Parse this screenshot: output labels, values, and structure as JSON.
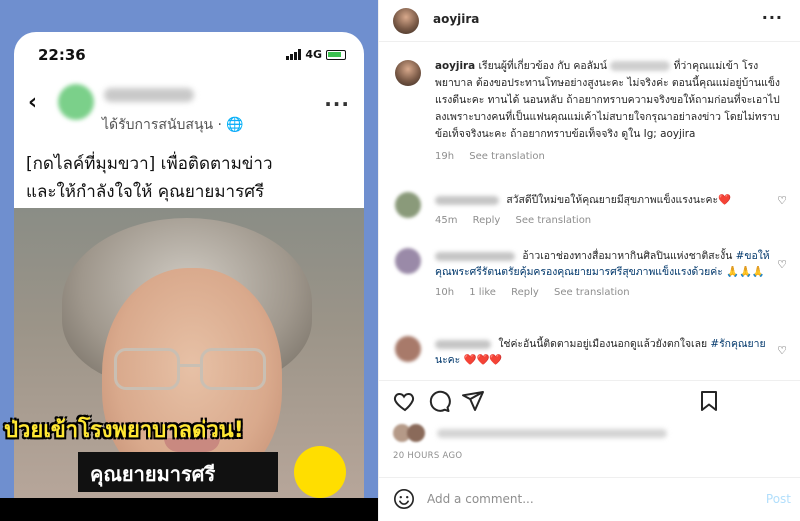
{
  "left": {
    "status_time": "22:36",
    "network": "4G",
    "fb_sponsored": "ได้รับการสนับสนุน · 🌐",
    "fb_text_line1": "[กดไลค์ที่มุมขวา] เพื่อติดตามข่าว",
    "fb_text_line2": "และให้กำลังใจให้ คุณยายมารศรี",
    "banner": "ป่วยเข้าโรงพยาบาลด่วน!",
    "banner2": "คุณยายมารศรี",
    "back_glyph": "‹",
    "more_glyph": "···"
  },
  "header": {
    "username": "aoyjira",
    "more_glyph": "···"
  },
  "caption": {
    "username": "aoyjira",
    "text_a": "เรียนผู้ที่เกี่ยวข้อง กับ คอลัมน์",
    "text_b": "ที่ว่าคุณแม่เข้า โรงพยาบาล ต้องขอประทานโทษอย่างสูงนะคะ ไม่จริงค่ะ ตอนนี้คุณแม่อยู่บ้านแข็งแรงดีนะคะ ทานได้ นอนหลับ ถ้าอยากทราบความจริงขอให้ถามก่อนที่จะเอาไปลงเพราะบางคนที่เป็นแฟนคุณแม่เค้าไม่สบายใจกรุณาอย่าลงข่าว โดยไม่ทราบข้อเท็จจริงนะคะ ถ้าอยากทราบข้อเท็จจริง ดูใน Ig; aoyjira",
    "time": "19h",
    "see_translation": "See translation"
  },
  "comments": [
    {
      "text": "สวัสดีปีใหม่ขอให้คุณยายมีสุขภาพแข็งแรงนะคะ❤️",
      "tag": "",
      "time": "45m",
      "likes": "",
      "reply": "Reply",
      "see_translation": "See translation"
    },
    {
      "text": "อ้าวเอาช่องทางสื่อมาหากินศิลปินแห่งชาติสะงั้น",
      "tag": "#ขอให้คุณพระศรีรัตนตรัยคุ้มครองคุณยายมารศรีสุขภาพแข็งแรงด้วยค่ะ",
      "emoji": "🙏🙏🙏",
      "time": "10h",
      "likes": "1 like",
      "reply": "Reply",
      "see_translation": "See translation"
    },
    {
      "text": "ใช่ค่ะอันนี้ติดตามอยู่เมืองนอกดูแล้วยังตกใจเลย",
      "tag": "#รักคุณยายนะคะ",
      "emoji": "❤️❤️❤️",
      "time": "",
      "likes": "",
      "reply": "",
      "see_translation": ""
    }
  ],
  "footer": {
    "time_ago": "20 HOURS AGO",
    "comment_placeholder": "Add a comment...",
    "post_label": "Post"
  },
  "colors": {
    "accent_link": "#00376b",
    "post_disabled": "#b2dffc",
    "muted": "#8e8e8e"
  }
}
